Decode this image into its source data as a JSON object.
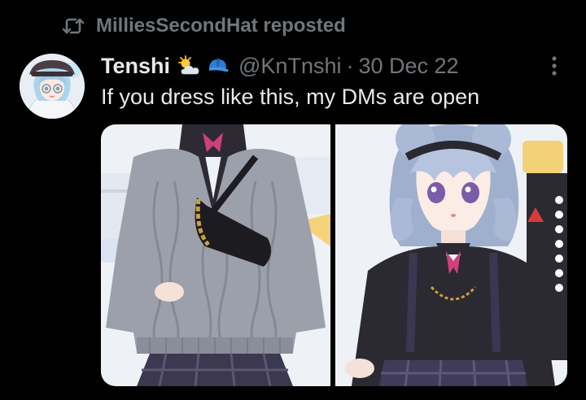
{
  "repost": {
    "icon": "repost-icon",
    "text": "MilliesSecondHat reposted"
  },
  "author": {
    "display_name": "Tenshi",
    "name_emoji": [
      "sun-behind-cloud-emoji",
      "blue-cap-emoji"
    ],
    "handle": "@KnTnshi",
    "separator": "·",
    "date": "30 Dec 22",
    "avatar": "avatar-anime-character"
  },
  "tweet": {
    "text": "If you dress like this, my DMs are open"
  },
  "media": {
    "images": [
      {
        "name": "media-image-outfit-torso"
      },
      {
        "name": "media-image-character-portrait"
      }
    ]
  },
  "colors": {
    "background": "#000000",
    "primary_text": "#e7e9ea",
    "secondary_text": "#71767b"
  },
  "menu": {
    "icon": "more-options-icon"
  }
}
